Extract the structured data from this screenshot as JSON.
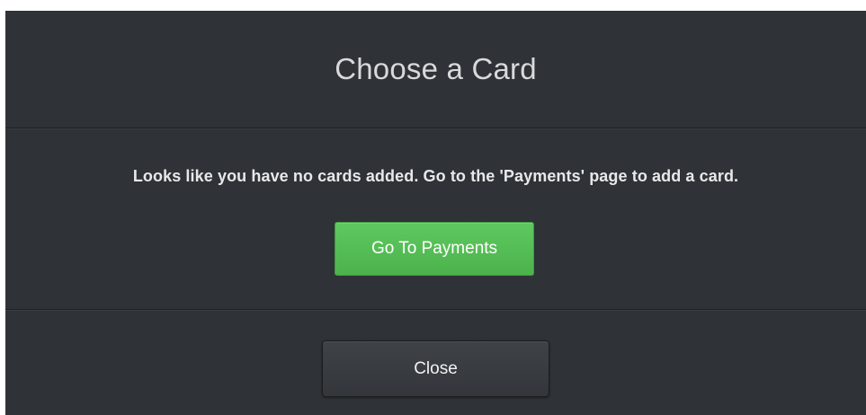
{
  "dialog": {
    "title": "Choose a Card",
    "message": "Looks like you have no cards added. Go to the 'Payments' page to add a card.",
    "primary_button_label": "Go To Payments",
    "close_button_label": "Close"
  },
  "colors": {
    "dialog_background": "#2f3236",
    "primary_button": "#56bd56",
    "close_button": "#3a3d42"
  }
}
